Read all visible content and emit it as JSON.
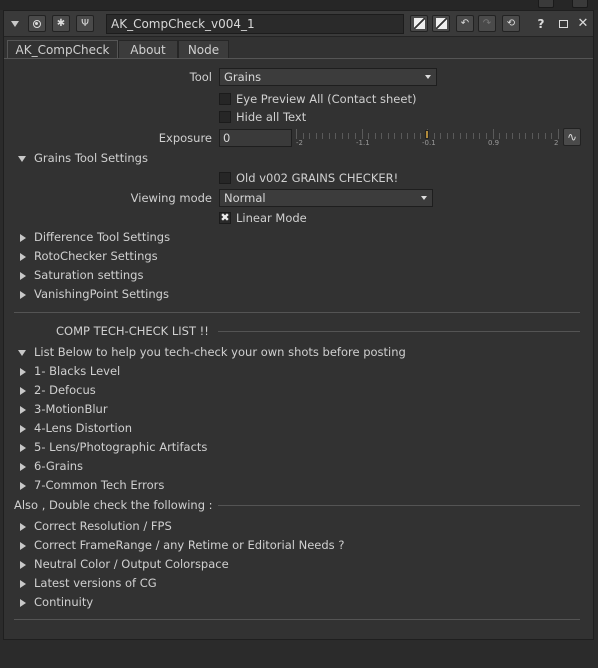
{
  "node": {
    "name": "AK_CompCheck_v004_1"
  },
  "tabs": [
    {
      "label": "AK_CompCheck"
    },
    {
      "label": "About"
    },
    {
      "label": "Node"
    }
  ],
  "controls": {
    "tool": {
      "label": "Tool",
      "value": "Grains"
    },
    "eye_preview": {
      "label": "Eye Preview All (Contact sheet)",
      "checked": false
    },
    "hide_text": {
      "label": "Hide all Text",
      "checked": false
    },
    "exposure": {
      "label": "Exposure",
      "value": "0",
      "tick_labels": [
        "-2",
        "-1.1",
        "-0.1",
        "0.9",
        "2"
      ],
      "slider_position": 0.5
    }
  },
  "grains_settings": {
    "label": "Grains Tool Settings",
    "old_checker": {
      "label": "Old v002 GRAINS CHECKER!",
      "checked": false
    },
    "viewing_mode": {
      "label": "Viewing mode",
      "value": "Normal"
    },
    "linear_mode": {
      "label": "Linear Mode",
      "checked": true
    }
  },
  "collapsed_groups": [
    {
      "label": "Difference Tool Settings"
    },
    {
      "label": "RotoChecker Settings"
    },
    {
      "label": "Saturation settings"
    },
    {
      "label": "VanishingPoint Settings"
    }
  ],
  "checklist": {
    "title": "COMP TECH-CHECK LIST !!",
    "intro": "List Below to help you tech-check your own shots before posting",
    "items": [
      {
        "label": "1- Blacks Level"
      },
      {
        "label": "2- Defocus"
      },
      {
        "label": "3-MotionBlur"
      },
      {
        "label": "4-Lens Distortion"
      },
      {
        "label": "5- Lens/Photographic Artifacts"
      },
      {
        "label": "6-Grains"
      },
      {
        "label": "7-Common Tech Errors"
      }
    ]
  },
  "double_check": {
    "title": "Also , Double check the following :",
    "items": [
      {
        "label": "Correct Resolution / FPS"
      },
      {
        "label": "Correct FrameRange / any Retime or Editorial Needs ?"
      },
      {
        "label": "Neutral Color / Output Colorspace"
      },
      {
        "label": "Latest versions of CG"
      },
      {
        "label": "Continuity"
      }
    ]
  }
}
